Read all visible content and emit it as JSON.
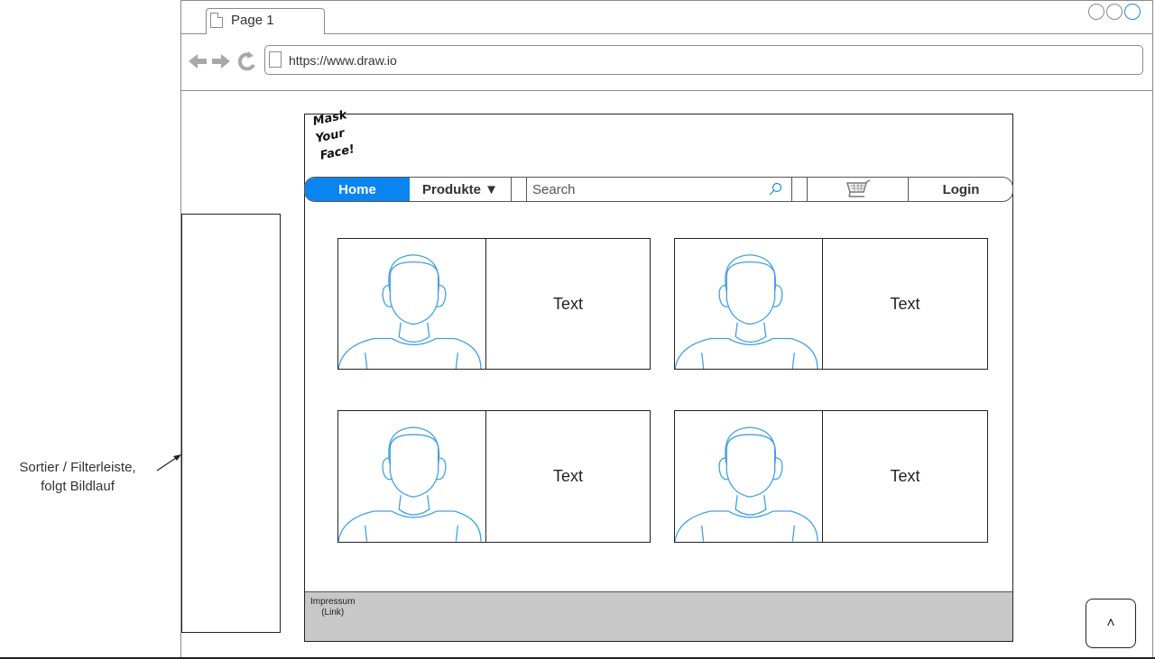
{
  "browser": {
    "tab_label": "Page 1",
    "url": "https://www.draw.io",
    "accent_color": "#1a8cf0"
  },
  "annotation": {
    "line1": "Sortier / Filterleiste,",
    "line2": "folgt Bildlauf"
  },
  "logo": {
    "line1": "Mask",
    "line2": "Your",
    "line3": "Face!"
  },
  "nav": {
    "home": "Home",
    "produkte": "Produkte ▼",
    "search_placeholder": "Search",
    "login": "Login",
    "active_color": "#0a84f0"
  },
  "cards": [
    {
      "text": "Text",
      "icon": "person-avatar-icon"
    },
    {
      "text": "Text",
      "icon": "person-avatar-icon"
    },
    {
      "text": "Text",
      "icon": "person-avatar-icon"
    },
    {
      "text": "Text",
      "icon": "person-avatar-icon"
    }
  ],
  "footer": {
    "link_line1": "Impressum",
    "link_line2": "(Link)"
  },
  "scroll_top": "˄"
}
